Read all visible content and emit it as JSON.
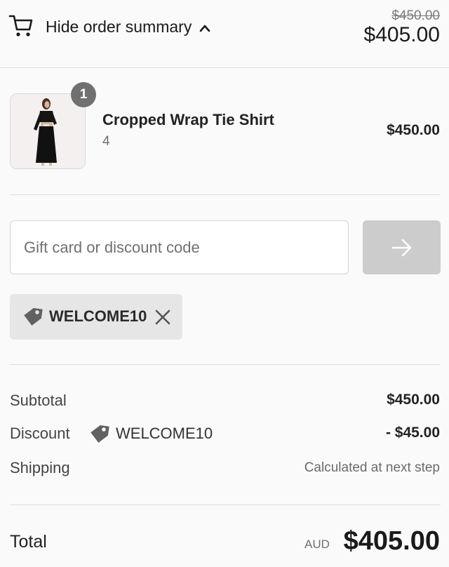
{
  "header": {
    "toggle_label": "Hide order summary",
    "original_total": "$450.00",
    "total": "$405.00"
  },
  "product": {
    "quantity_badge": "1",
    "name": "Cropped Wrap Tie Shirt",
    "variant": "4",
    "price": "$450.00"
  },
  "discount": {
    "placeholder": "Gift card or discount code",
    "value": "",
    "applied_code": "WELCOME10"
  },
  "summary": {
    "subtotal_label": "Subtotal",
    "subtotal_value": "$450.00",
    "discount_label": "Discount",
    "discount_code": "WELCOME10",
    "discount_value": "- $45.00",
    "shipping_label": "Shipping",
    "shipping_value": "Calculated at next step"
  },
  "total": {
    "label": "Total",
    "currency": "AUD",
    "value": "$405.00"
  },
  "icons": {
    "cart": "cart-icon",
    "chevron": "chevron-up-icon",
    "arrow": "arrow-right-icon",
    "tag": "tag-icon",
    "close": "close-icon"
  },
  "colors": {
    "apply_button_disabled": "#cccccc",
    "chip_background": "#e6e6e6",
    "badge": "#707070"
  }
}
